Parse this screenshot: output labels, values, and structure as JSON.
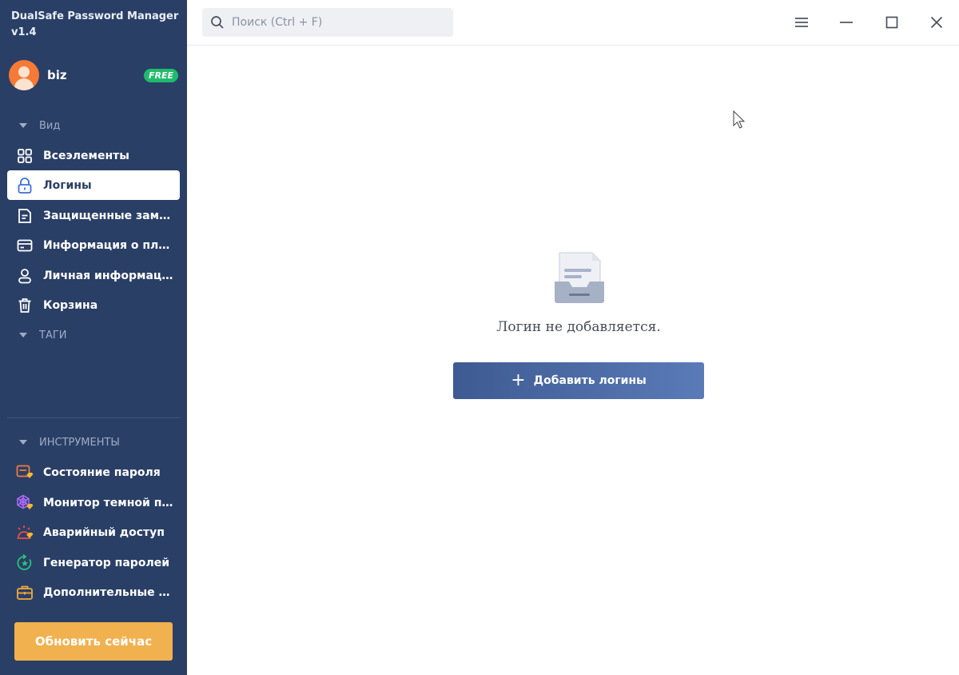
{
  "app": {
    "title": "DualSafe Password Manager v1.4"
  },
  "user": {
    "name": "biz",
    "plan_badge": "FREE"
  },
  "view_section": {
    "label": "Вид"
  },
  "nav": [
    {
      "label": "Всеэлементы",
      "icon": "grid-icon"
    },
    {
      "label": "Логины",
      "icon": "lock-icon",
      "active": true
    },
    {
      "label": "Защищенные заметки",
      "icon": "note-icon"
    },
    {
      "label": "Информация о платеже",
      "icon": "card-icon"
    },
    {
      "label": "Личная информация",
      "icon": "person-icon"
    },
    {
      "label": "Корзина",
      "icon": "trash-icon"
    }
  ],
  "tags_section": {
    "label": "ТАГИ"
  },
  "tools_section": {
    "label": "ИНСТРУМЕНТЫ"
  },
  "tools": [
    {
      "label": "Состояние пароля",
      "icon": "password-health-icon"
    },
    {
      "label": "Монитор темной паутины",
      "icon": "dark-web-monitor-icon"
    },
    {
      "label": "Аварийный доступ",
      "icon": "emergency-access-icon"
    },
    {
      "label": "Генератор паролей",
      "icon": "password-generator-icon"
    },
    {
      "label": "Дополнительные инструменты",
      "icon": "briefcase-icon"
    }
  ],
  "upgrade": {
    "label": "Обновить сейчас"
  },
  "search": {
    "placeholder": "Поиск (Ctrl + F)",
    "value": ""
  },
  "empty_state": {
    "message": "Логин не добавляется.",
    "button_label": "Добавить логины"
  },
  "colors": {
    "sidebar_bg": "#2a3f66",
    "accent_orange": "#f1b14f",
    "badge_green": "#1fbb6c",
    "primary_button": "#4a6aa8"
  }
}
